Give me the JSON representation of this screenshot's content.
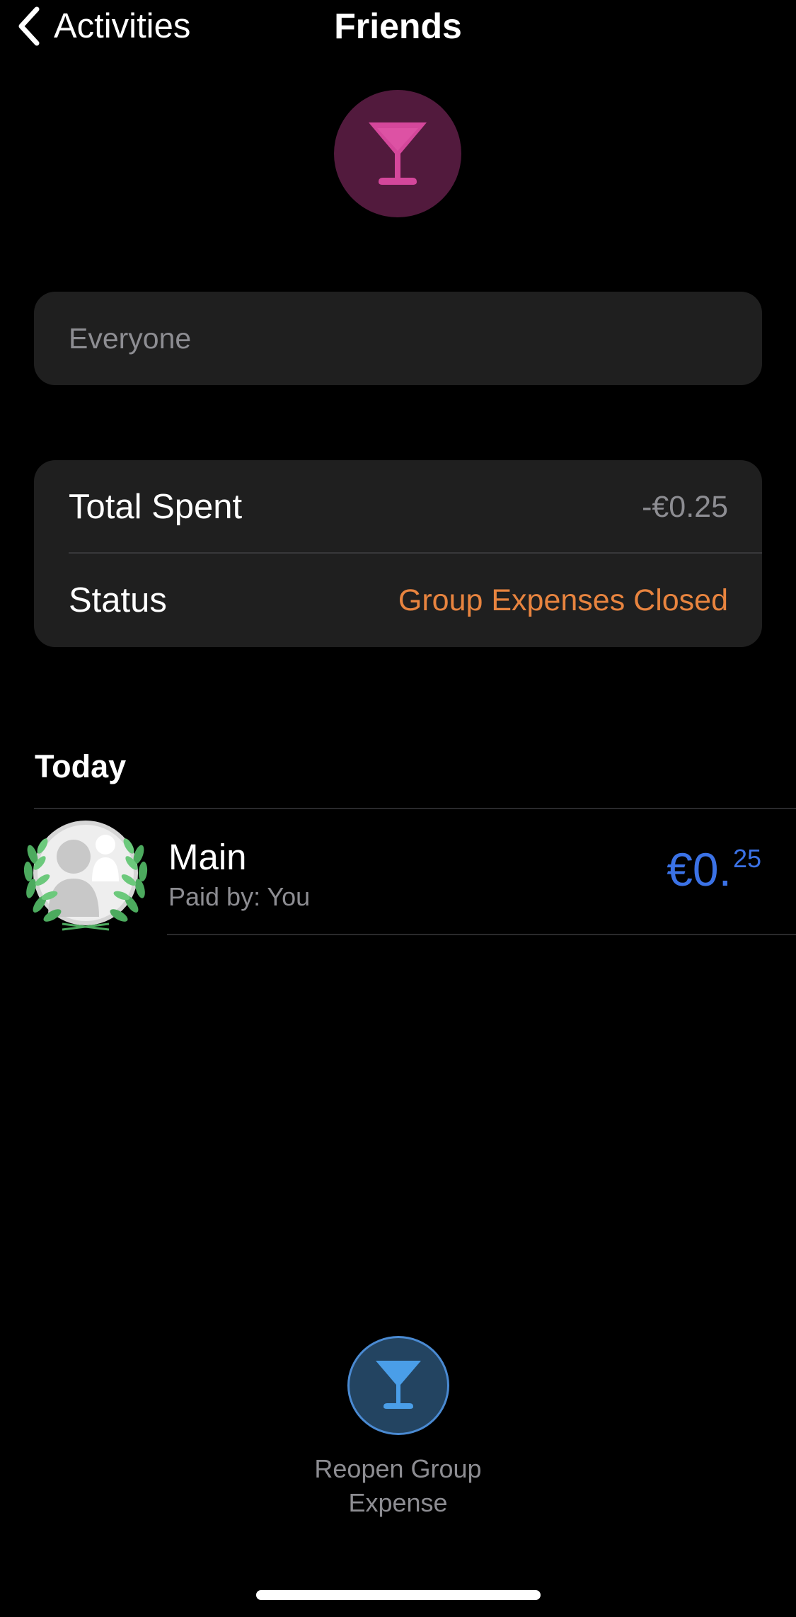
{
  "nav": {
    "back_label": "Activities",
    "title": "Friends"
  },
  "hero": {
    "icon": "cocktail-glass-icon",
    "accent": "#d4479b",
    "background": "#521a3d"
  },
  "participants": {
    "placeholder": "Everyone"
  },
  "summary": {
    "rows": [
      {
        "label": "Total Spent",
        "value": "-€0.25"
      },
      {
        "label": "Status",
        "value": "Group Expenses Closed"
      }
    ],
    "status_color": "#e8843f"
  },
  "section": {
    "title": "Today"
  },
  "expenses": [
    {
      "name": "Main",
      "paid_by": "Paid by: You",
      "amount_main": "€0.",
      "amount_cents": "25",
      "icon": "laurel-avatar-icon"
    }
  ],
  "reopen": {
    "label": "Reopen Group Expense",
    "icon": "cocktail-glass-icon",
    "accent": "#4a9ee8"
  }
}
